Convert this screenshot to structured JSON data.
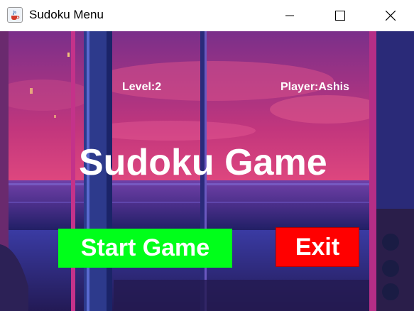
{
  "window": {
    "title": "Sudoku Menu",
    "icon": "java-cup-icon",
    "controls": [
      "minimize-icon",
      "maximize-icon",
      "close-icon"
    ]
  },
  "menu": {
    "level": "Level:2",
    "player": "Player:Ashis",
    "game_title": "Sudoku Game",
    "start_label": "Start Game",
    "exit_label": "Exit"
  },
  "colors": {
    "start_button": "#00ff1a",
    "exit_button": "#ff0000",
    "text": "#ffffff"
  }
}
